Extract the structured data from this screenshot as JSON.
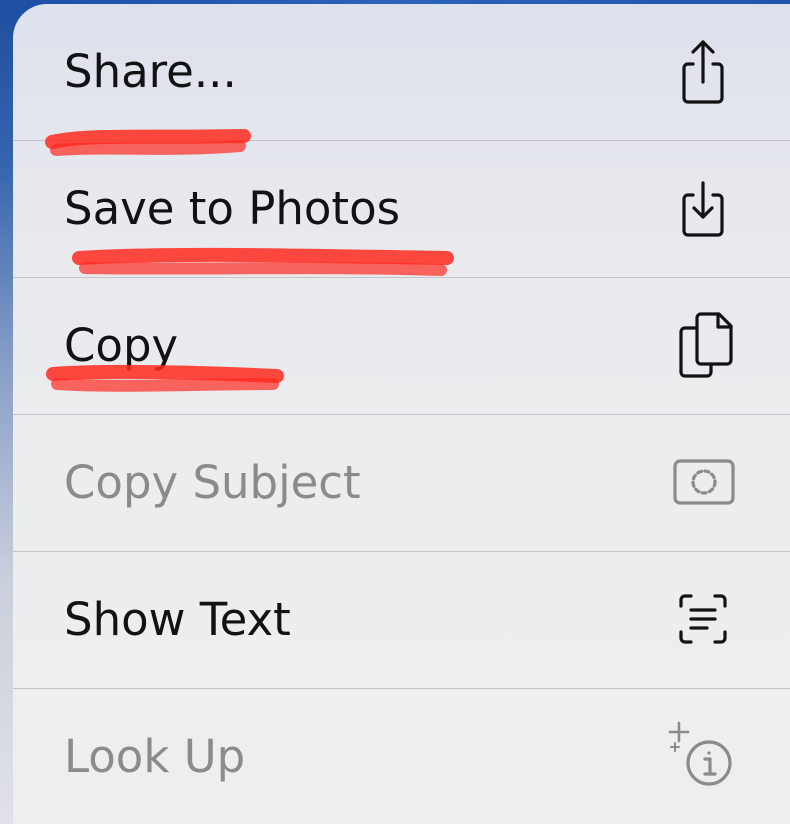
{
  "menu": {
    "items": [
      {
        "label": "Share...",
        "icon": "share-icon",
        "enabled": true
      },
      {
        "label": "Save to Photos",
        "icon": "save-to-photos-icon",
        "enabled": true
      },
      {
        "label": "Copy",
        "icon": "copy-icon",
        "enabled": true
      },
      {
        "label": "Copy Subject",
        "icon": "copy-subject-icon",
        "enabled": false
      },
      {
        "label": "Show Text",
        "icon": "show-text-icon",
        "enabled": true
      },
      {
        "label": "Look Up",
        "icon": "look-up-icon",
        "enabled": false
      }
    ]
  },
  "colors": {
    "enabled_text": "#121214",
    "disabled_text": "#8b8b8e",
    "scribble": "#ff2a1f",
    "divider": "#c4c4c8"
  }
}
